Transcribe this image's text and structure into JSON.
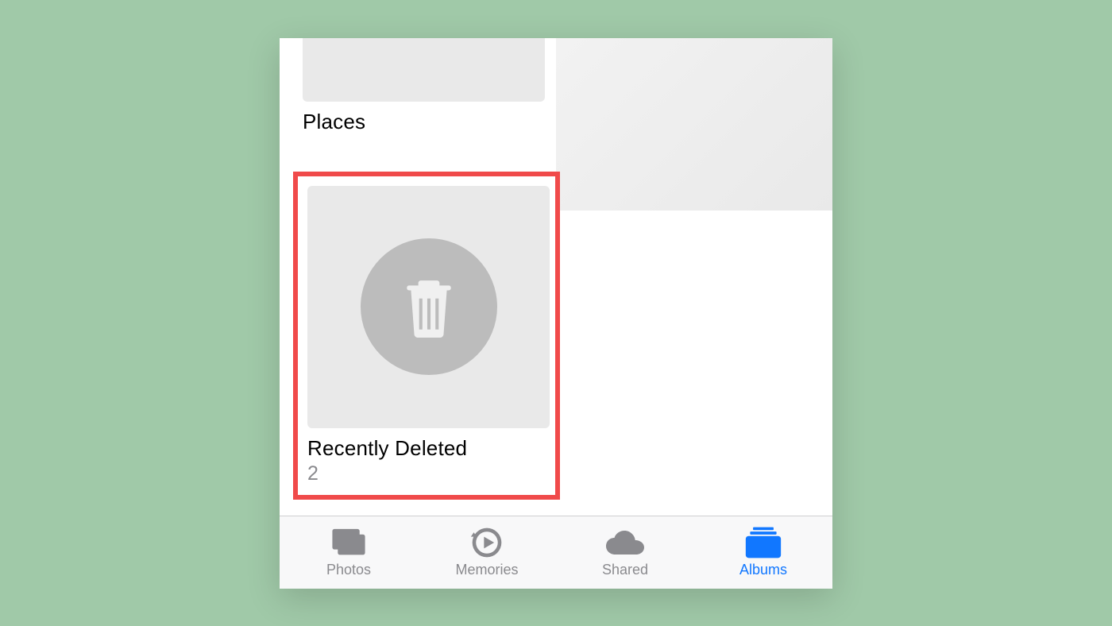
{
  "albums": {
    "places": {
      "title": "Places"
    },
    "recently_deleted": {
      "title": "Recently Deleted",
      "count": "2"
    }
  },
  "tabs": {
    "photos": {
      "label": "Photos"
    },
    "memories": {
      "label": "Memories"
    },
    "shared": {
      "label": "Shared"
    },
    "albums": {
      "label": "Albums"
    }
  },
  "highlight_color": "#f04a4a",
  "accent_color": "#1177ff"
}
